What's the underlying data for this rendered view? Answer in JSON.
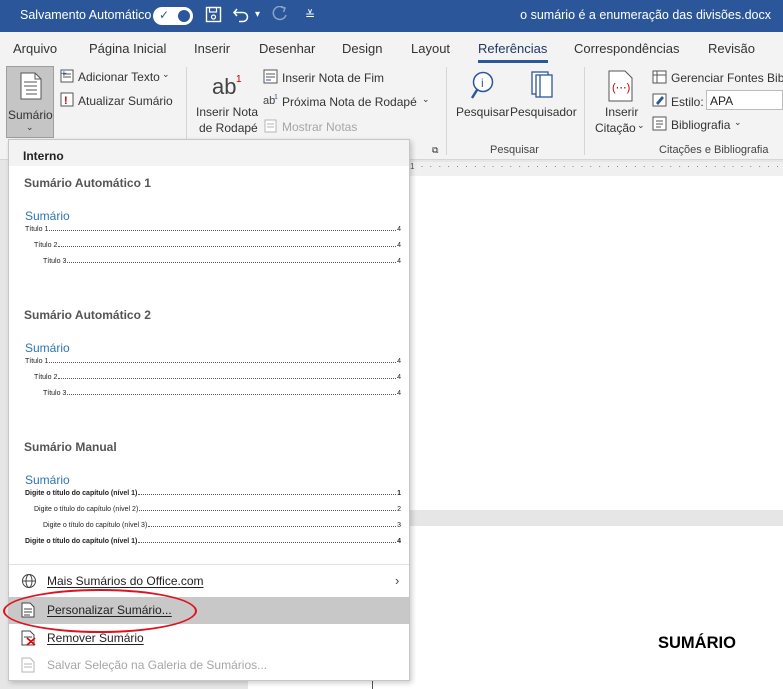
{
  "titlebar": {
    "autosave_label": "Salvamento Automático",
    "autosave_state": "on",
    "document_title": "o sumário é a enumeração das divisões.docx",
    "accent_color": "#2b579a"
  },
  "tabs": [
    {
      "label": "Arquivo"
    },
    {
      "label": "Página Inicial"
    },
    {
      "label": "Inserir"
    },
    {
      "label": "Desenhar"
    },
    {
      "label": "Design"
    },
    {
      "label": "Layout"
    },
    {
      "label": "Referências",
      "active": true
    },
    {
      "label": "Correspondências"
    },
    {
      "label": "Revisão"
    }
  ],
  "ribbon": {
    "sumario": {
      "label": "Sumário",
      "icon": "toc-icon"
    },
    "adicionar_texto": "Adicionar Texto",
    "atualizar_sumario": "Atualizar Sumário",
    "inserir_nota_line1": "Inserir Nota",
    "inserir_nota_line2": "de Rodapé",
    "inserir_nota_fim": "Inserir Nota de Fim",
    "proxima_nota": "Próxima Nota de Rodapé",
    "mostrar_notas": "Mostrar Notas",
    "pesquisar": "Pesquisar",
    "pesquisador": "Pesquisador",
    "pesquisar_group": "Pesquisar",
    "inserir_citacao_line1": "Inserir",
    "inserir_citacao_line2": "Citação",
    "gerenciar_fontes": "Gerenciar Fontes Bibl",
    "estilo_label": "Estilo:",
    "estilo_value": "APA",
    "bibliografia": "Bibliografia",
    "citacoes_group": "Citações e Bibliografia"
  },
  "dropdown": {
    "section_label": "Interno",
    "galleries": [
      {
        "title": "Sumário Automático 1",
        "preview_title": "Sumário",
        "rows": [
          {
            "text": "Título 1",
            "page": "4",
            "level": 1
          },
          {
            "text": "Título 2",
            "page": "4",
            "level": 2
          },
          {
            "text": "Título 3",
            "page": "4",
            "level": 3
          }
        ]
      },
      {
        "title": "Sumário Automático 2",
        "preview_title": "Sumário",
        "rows": [
          {
            "text": "Título 1",
            "page": "4",
            "level": 1
          },
          {
            "text": "Título 2",
            "page": "4",
            "level": 2
          },
          {
            "text": "Título 3",
            "page": "4",
            "level": 3
          }
        ]
      },
      {
        "title": "Sumário Manual",
        "preview_title": "Sumário",
        "rows": [
          {
            "text": "Digite o título do capítulo (nível 1)",
            "page": "1",
            "level": 1
          },
          {
            "text": "Digite o título do capítulo (nível 2)",
            "page": "2",
            "level": 2
          },
          {
            "text": "Digite o título do capítulo (nível 3)",
            "page": "3",
            "level": 3
          },
          {
            "text": "Digite o título do capítulo (nível 1)",
            "page": "4",
            "level": 1
          }
        ]
      }
    ],
    "menu": {
      "mais_sumarios": "Mais Sumários do Office.com",
      "personalizar": "Personalizar Sumário...",
      "remover": "Remover Sumário",
      "salvar": "Salvar Seleção na Galeria de Sumários..."
    },
    "highlight_color": "#e0121f"
  },
  "document": {
    "heading": "SUMÁRIO"
  }
}
